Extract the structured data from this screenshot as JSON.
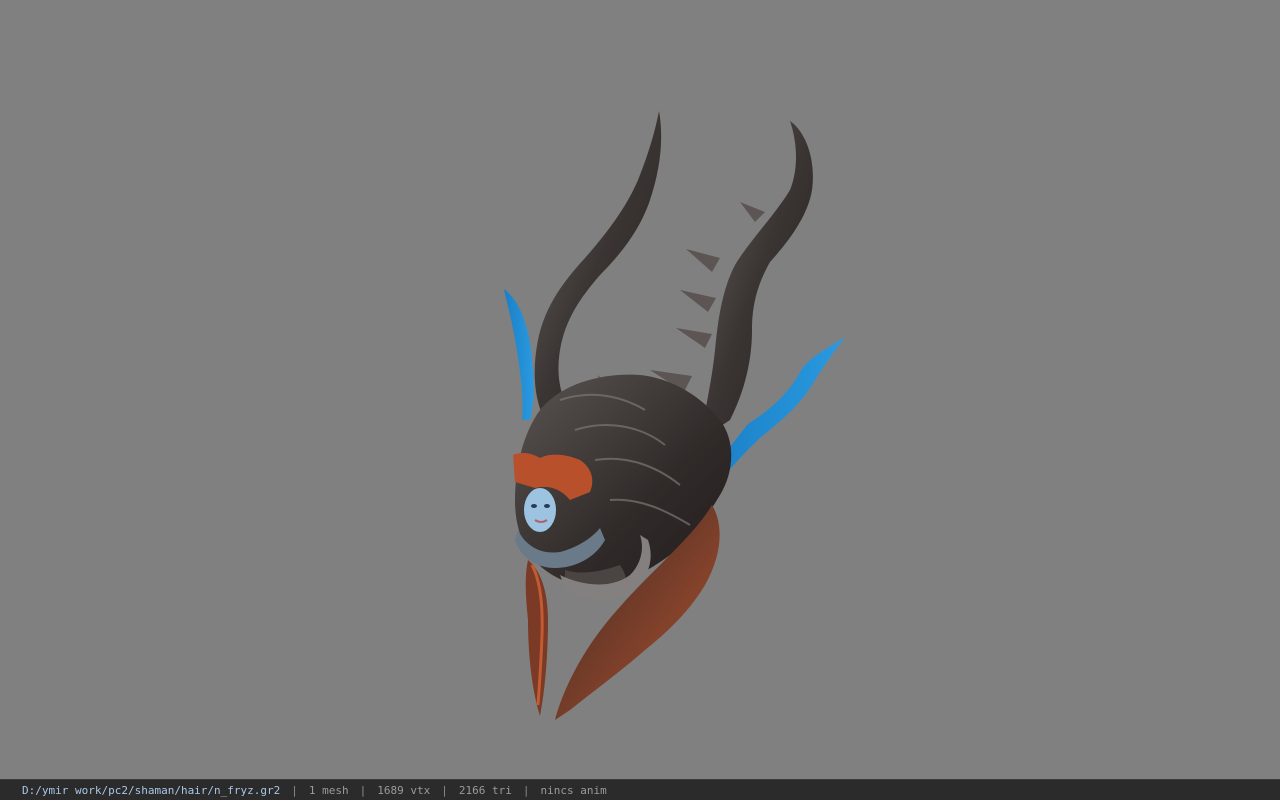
{
  "viewport": {
    "background": "#808080",
    "model_description": "horned-helmet-model"
  },
  "status_bar": {
    "file_path": "D:/ymir work/pc2/shaman/hair/n_fryz.gr2",
    "separator": "|",
    "mesh_count": "1 mesh",
    "vertex_count": "1689 vtx",
    "triangle_count": "2166 tri",
    "anim_status": "nincs anim"
  }
}
